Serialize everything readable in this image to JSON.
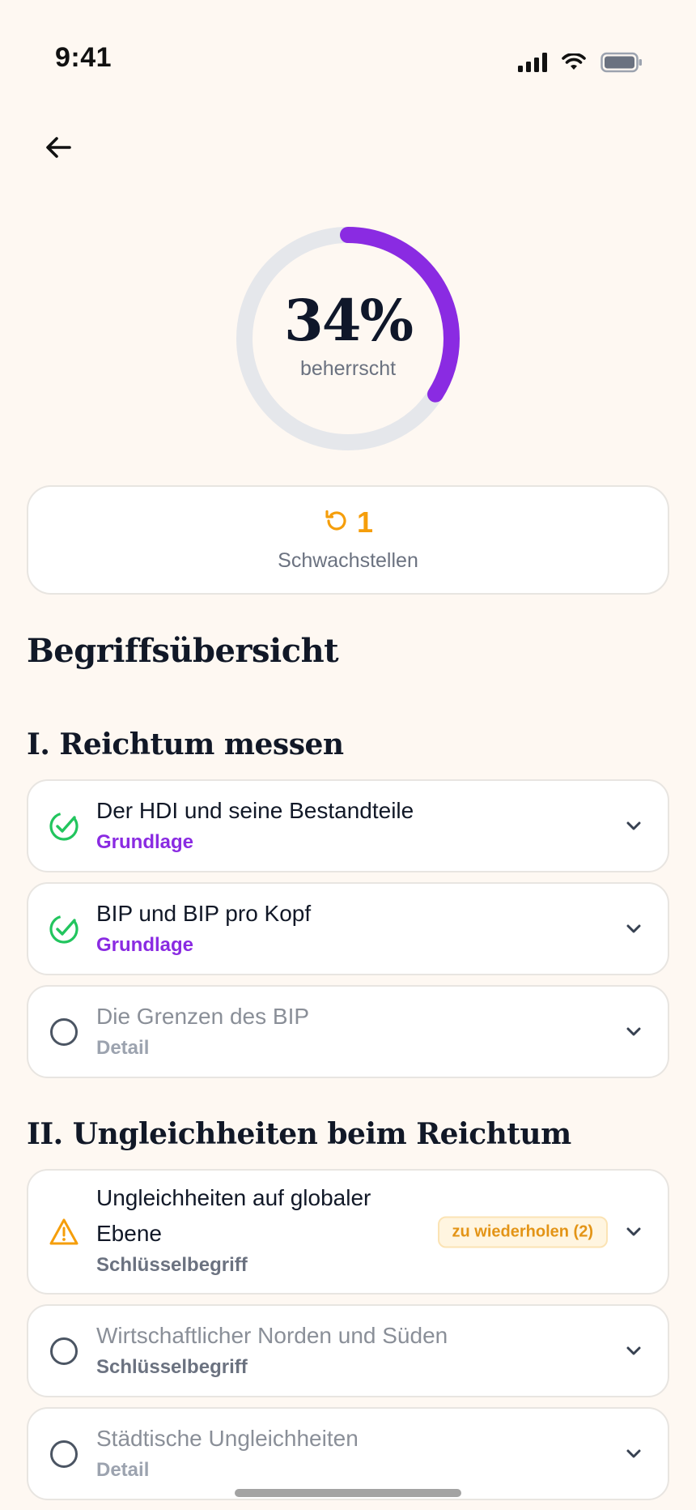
{
  "status_bar": {
    "time": "9:41"
  },
  "progress": {
    "percent_label": "34%",
    "value": 0.34,
    "label": "beherrscht",
    "accent_color": "#8a2be2",
    "track_color": "#e5e7eb"
  },
  "weak_points": {
    "count": "1",
    "label": "Schwachstellen",
    "color": "#f59e0b"
  },
  "overview_title": "Begriffsübersicht",
  "sections": [
    {
      "title": "I. Reichtum messen",
      "items": [
        {
          "title": "Der HDI und seine Bestandteile",
          "category": "Grundlage",
          "status": "mastered"
        },
        {
          "title": "BIP und BIP pro Kopf",
          "category": "Grundlage",
          "status": "mastered"
        },
        {
          "title": "Die Grenzen des BIP",
          "category": "Detail",
          "status": "open"
        }
      ]
    },
    {
      "title": "II. Ungleichheiten beim Reichtum",
      "items": [
        {
          "title_line1": "Ungleichheiten auf globaler",
          "title_line2": "Ebene",
          "category": "Schlüsselbegriff",
          "status": "review",
          "badge": "zu wiederholen (2)"
        },
        {
          "title": "Wirtschaftlicher Norden und Süden",
          "category": "Schlüsselbegriff",
          "status": "open"
        },
        {
          "title": "Städtische Ungleichheiten",
          "category": "Detail",
          "status": "open"
        }
      ]
    }
  ],
  "icons": {
    "back": "arrow-left-icon",
    "mastered": "check-circle-icon",
    "open": "empty-circle-icon",
    "review": "warning-triangle-icon",
    "weak": "refresh-icon",
    "expand": "chevron-down-icon"
  }
}
